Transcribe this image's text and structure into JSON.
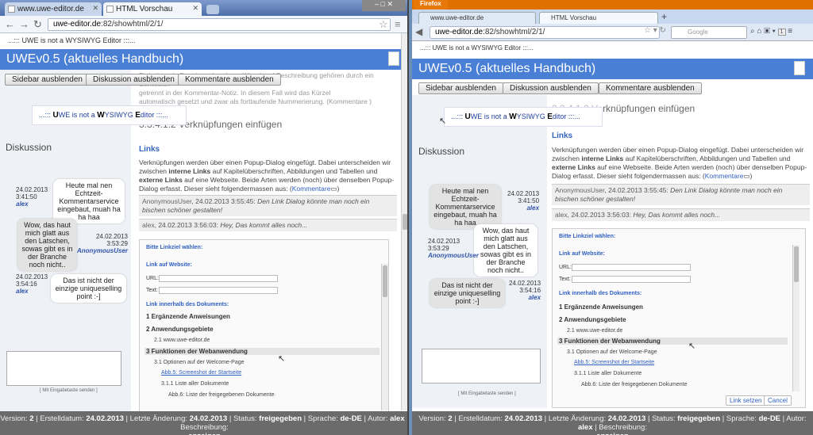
{
  "left": {
    "tabs": [
      {
        "label": "www.uwe-editor.de"
      },
      {
        "label": "HTML Vorschau"
      }
    ],
    "url_host": "uwe-editor.de",
    "url_rest": ":82/showhtml/2/1/"
  },
  "right": {
    "firefox_label": "Firefox",
    "tabs": [
      {
        "label": "www.uwe-editor.de"
      },
      {
        "label": "HTML Vorschau"
      }
    ],
    "url_host": "uwe-editor.de",
    "url_rest": ":82/showhtml/2/1/",
    "search_placeholder": "Google",
    "badge": "1"
  },
  "page": {
    "logo_line": "...::: UWE is not a WYSIWYG Editor :::...",
    "title": "UWEv0.5 (aktuelles Handbuch)",
    "buttons": {
      "sidebar": "Sidebar ausblenden",
      "discussion": "Diskussion ausblenden",
      "comments": "Kommentare ausblenden"
    },
    "banner_pre": "...::: ",
    "banner_u": "U",
    "banner_we": "WE is not a ",
    "banner_w": "W",
    "banner_ysiwyg": "YSIWYG ",
    "banner_e": "E",
    "banner_post": "ditor :::...",
    "discussion_heading": "Diskussion",
    "section_heading": "3.3.4.1.2 Verknüpfungen einfügen",
    "section_heading_tail": "rknüpfungen einfügen",
    "links_heading": "Links",
    "para": [
      "Verknüpfungen werden über einen Popup-Dialog eingefügt. Dabei unterscheiden wir zwischen ",
      "interne Links",
      " auf Kapitelüberschriften, Abbildungen und Tabellen und ",
      "externe Links",
      " auf eine Webseite. Beide Arten werden (noch) über denselben Popup-Dialog erfasst. Dieser sieht folgendermassen aus: ("
    ],
    "kommentare": "Kommentare",
    "para_close": ")",
    "top_text_1": "Einheiten ein Paar bestehend aus Kürzel und Beschreibung gehören durch ein Semikolon",
    "top_text_2": "getrennt in der Kommentar-Notiz. In diesem Fall wird das Kürzel",
    "top_text_3": "automatisch gesetzt und zwar als fortlaufende Nummerierung. (Kommentare )",
    "comments": [
      {
        "user": "AnonymousUser",
        "date": "24.02.2013 3:55:45:",
        "text": "Den Link Dialog könnte man noch ein bischen schöner gestalten!"
      },
      {
        "user": "alex",
        "date": "24.02.2013 3:56:03:",
        "text": "Hey, Das kommt alles noch..."
      }
    ],
    "chat": [
      {
        "text": "Heute mal nen Echtzeit-Kommentarservice eingebaut, muah ha ha haa",
        "date": "24.02.2013",
        "time": "3:41:50",
        "user": "alex"
      },
      {
        "text": "Wow, das haut mich glatt aus den Latschen, sowas gibt es in der Branche noch nicht..",
        "date": "24.02.2013",
        "time": "3:53:29",
        "user": "AnonymousUser"
      },
      {
        "text": "Das ist nicht der einzige uniqueselling point :-]",
        "date": "24.02.2013",
        "time": "3:54:16",
        "user": "alex"
      }
    ],
    "textarea_note": "[ Mit Eingabetaste senden ]",
    "dialog": {
      "title": "Bitte Linkziel wählen:",
      "website": "Link auf Website:",
      "url_label": "URL:",
      "text_label": "Text:",
      "doc_links": "Link innerhalb des Dokuments:",
      "items": [
        {
          "label": "1 Ergänzende Anweisungen",
          "level": 1
        },
        {
          "label": "2 Anwendungsgebiete",
          "level": 1
        },
        {
          "label": "2.1 www.uwe-editor.de",
          "level": 2
        },
        {
          "label": "3 Funktionen der Webanwendung",
          "level": 1
        },
        {
          "label": "3.1 Optionen auf der Welcome-Page",
          "level": 2
        },
        {
          "label": "Abb.5: Screenshot der Startseite",
          "level": 3
        },
        {
          "label": "3.1.1 Liste aller Dokumente",
          "level": 2
        },
        {
          "label": "Abb.6: Liste der freigegebenen Dokumente",
          "level": 2
        }
      ],
      "set_link": "Link setzen",
      "cancel": "Cancel"
    },
    "footer": {
      "version_label": "Version:",
      "version": "2",
      "created_label": "Erstelldatum:",
      "created": "24.02.2013",
      "changed_label": "Letzte Änderung:",
      "changed": "24.02.2013",
      "status_label": "Status:",
      "status": "freigegeben",
      "lang_label": "Sprache:",
      "lang": "de-DE",
      "author_label": "Autor:",
      "author": "alex",
      "desc_label": "Beschreibung:",
      "desc_link": "anzeigen"
    }
  }
}
